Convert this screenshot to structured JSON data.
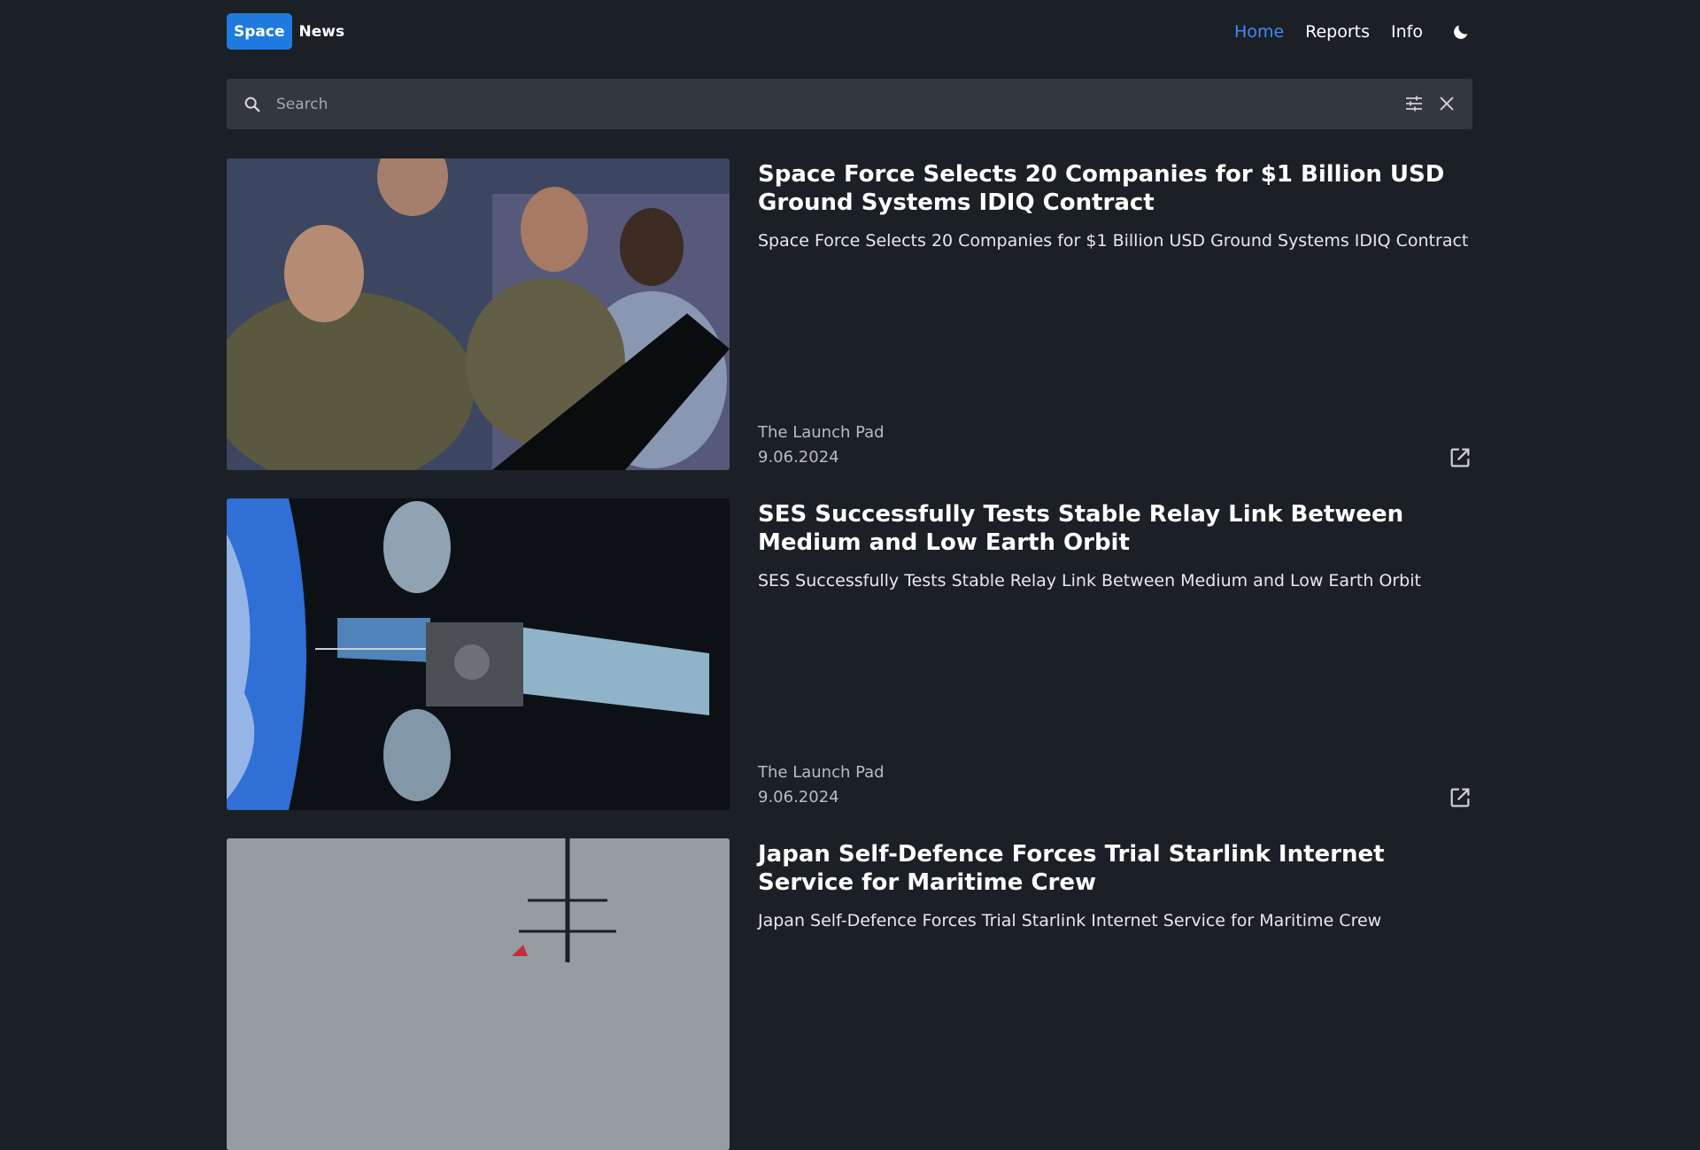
{
  "brand": {
    "badge": "Space",
    "text": "News"
  },
  "nav": {
    "home": "Home",
    "reports": "Reports",
    "info": "Info",
    "theme_icon": "moon-icon",
    "accent": "#3d8bfd"
  },
  "search": {
    "placeholder": "Search",
    "value": ""
  },
  "articles": [
    {
      "title": "Space Force Selects 20 Companies for $1 Billion USD Ground Systems IDIQ Contract",
      "summary": "Space Force Selects 20 Companies for $1 Billion USD Ground Systems IDIQ Contract",
      "source": "The Launch Pad",
      "date": "9.06.2024"
    },
    {
      "title": "SES Successfully Tests Stable Relay Link Between Medium and Low Earth Orbit",
      "summary": "SES Successfully Tests Stable Relay Link Between Medium and Low Earth Orbit",
      "source": "The Launch Pad",
      "date": "9.06.2024"
    },
    {
      "title": "Japan Self-Defence Forces Trial Starlink Internet Service for Maritime Crew",
      "summary": "Japan Self-Defence Forces Trial Starlink Internet Service for Maritime Crew",
      "source": "",
      "date": ""
    }
  ]
}
